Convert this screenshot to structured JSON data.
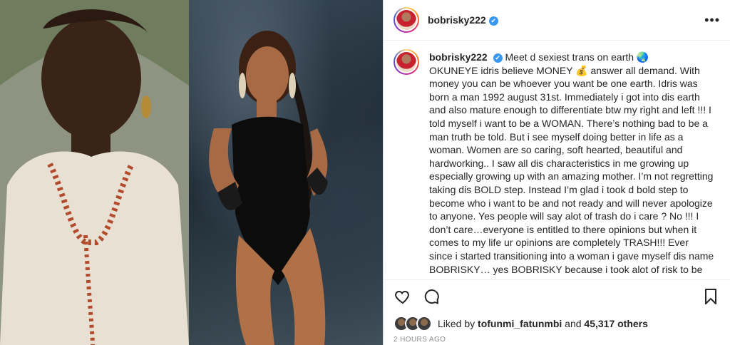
{
  "post": {
    "username": "bobrisky222",
    "verified_mark": "✔",
    "more_icon": "more-horizontal-icon",
    "caption_first_line": "Meet d sexiest trans on earth 🌏",
    "caption_body": "OKUNEYE idris believe MONEY 💰 answer all demand. With money you can be whoever you want be one earth. Idris was born a man 1992 august 31st. Immediately i got into dis earth and also mature enough to differentiate btw my right and left !!! I told myself i want to be a WOMAN. There’s nothing bad to be a man truth be told. But i see myself doing better in life as a woman. Women are so caring, soft hearted, beautiful and hardworking.. I saw all dis characteristics in me growing up especially growing up with an amazing mother. I’m not regretting taking dis BOLD step. Instead I’m glad i took d bold step to become who i want to be and not ready and will never apologize to anyone. Yes people will say alot of trash do i care ? No !!! I don’t care…everyone is entitled to there opinions but when it comes to my life ur opinions are completely TRASH!!! Ever since i started transitioning into a woman i gave myself dis name BOBRISKY… yes BOBRISKY because i took alot of risk to be",
    "likes_prefix": "Liked by",
    "liked_by_user": "tofunmi_fatunmbi",
    "likes_and": "and",
    "likes_count": "45,317 others",
    "timestamp": "2 HOURS AGO"
  },
  "icons": {
    "like": "heart-icon",
    "comment": "comment-icon",
    "save": "bookmark-icon"
  },
  "colors": {
    "verified": "#3897f0",
    "text": "#262626",
    "muted": "#8e8e8e"
  }
}
